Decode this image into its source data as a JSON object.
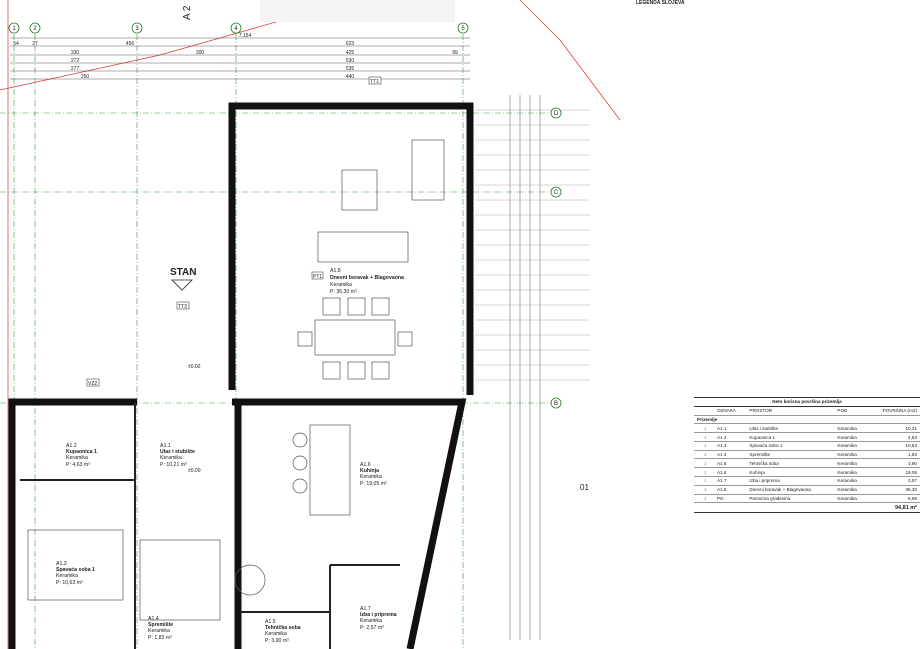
{
  "legend_title": "LEGENDA SLOJEVA",
  "grid_axes": {
    "columns": [
      "1",
      "2",
      "3",
      "4",
      "5"
    ],
    "rows": [
      "D",
      "C",
      "B"
    ]
  },
  "section_marks": [
    "A 2",
    "01"
  ],
  "stan_label": "STAN",
  "dimensions_top": [
    "7.154",
    "54",
    "27",
    "330",
    "456",
    "300",
    "623",
    "425",
    "99",
    "272",
    "530",
    "277",
    "535",
    "250",
    "440"
  ],
  "rooms": [
    {
      "code": "A1.8",
      "name": "Dnevni boravak + Blagovaona",
      "floor": "Keramika",
      "area": "P: 36,30 m²"
    },
    {
      "code": "A1.6",
      "name": "Kuhinja",
      "floor": "Keramika",
      "area": "P: 19,05 m²"
    },
    {
      "code": "A1.1",
      "name": "Ulaz i stubište",
      "floor": "Keramika",
      "area": "P: 10,21 m²"
    },
    {
      "code": "A1.2",
      "name": "Kupaonica 1",
      "floor": "Keramika",
      "area": "P: 4,63 m²"
    },
    {
      "code": "A1.3",
      "name": "Spavaća soba 1",
      "floor": "Keramika",
      "area": "P: 10,63 m²"
    },
    {
      "code": "A1.5",
      "name": "Tehnička soba",
      "floor": "Keramika",
      "area": "P: 3,90 m²"
    },
    {
      "code": "A1.7",
      "name": "Izba i priprema",
      "floor": "Keramika",
      "area": "P: 2,57 m²"
    },
    {
      "code": "A1.4",
      "name": "Spremište",
      "floor": "Keramika",
      "area": "P: 1,83 m²"
    }
  ],
  "tags": [
    "TT1",
    "TT3",
    "VZ2",
    "PT1",
    "±0.00",
    "±0.02"
  ],
  "area_table": {
    "title": "Neto korisna površina prizemlja",
    "headers": [
      "",
      "OZNAKA",
      "PROSTOR",
      "POD",
      "POVRŠINA (m2)"
    ],
    "section": "Prizemlje",
    "rows": [
      [
        "J",
        "A1.1",
        "Ulaz i stubište",
        "Keramika",
        "10,21"
      ],
      [
        "J",
        "A1.2",
        "Kupaonica 1",
        "Keramika",
        "4,63"
      ],
      [
        "J",
        "A1.3",
        "Spavaća soba 1",
        "Keramika",
        "10,63"
      ],
      [
        "J",
        "A1.4",
        "Spremište",
        "Keramika",
        "1,83"
      ],
      [
        "J",
        "A1.5",
        "Tehnička soba",
        "Keramika",
        "3,90"
      ],
      [
        "J",
        "A1.6",
        "Kuhinja",
        "Keramika",
        "19,05"
      ],
      [
        "J",
        "A1.7",
        "Izba i priprema",
        "Keramika",
        "2,57"
      ],
      [
        "J",
        "A1.8",
        "Dnevni boravak + Blagovaona",
        "Keramika",
        "36,30"
      ],
      [
        "J",
        "PG",
        "Pomoćna građevina",
        "Keramika",
        "5,69"
      ]
    ],
    "total": "94,81 m²"
  }
}
